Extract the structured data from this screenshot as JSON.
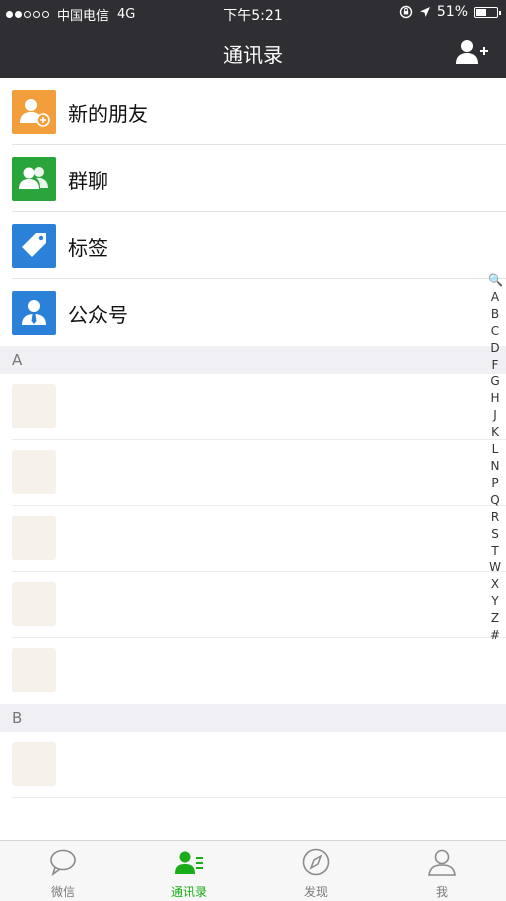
{
  "status_bar": {
    "carrier": "中国电信",
    "network": "4G",
    "time": "下午5:21",
    "battery": "51%",
    "battery_level": 0.51
  },
  "nav": {
    "title": "通讯录",
    "add_icon": "add-contact-icon"
  },
  "entries": [
    {
      "label": "新的朋友",
      "icon": "new-friends-icon",
      "color": "#f29f3b"
    },
    {
      "label": "群聊",
      "icon": "group-chat-icon",
      "color": "#2aa53c"
    },
    {
      "label": "标签",
      "icon": "tag-icon",
      "color": "#2b80d8"
    },
    {
      "label": "公众号",
      "icon": "official-account-icon",
      "color": "#2b80d8"
    }
  ],
  "sections": [
    {
      "letter": "A"
    },
    {
      "letter": "B"
    }
  ],
  "index_letters": [
    "🔍",
    "A",
    "B",
    "C",
    "D",
    "F",
    "G",
    "H",
    "J",
    "K",
    "L",
    "N",
    "P",
    "Q",
    "R",
    "S",
    "T",
    "W",
    "X",
    "Y",
    "Z",
    "#"
  ],
  "tabs": [
    {
      "label": "微信",
      "icon": "chat-icon",
      "active": false
    },
    {
      "label": "通讯录",
      "icon": "contacts-icon",
      "active": true
    },
    {
      "label": "发现",
      "icon": "compass-icon",
      "active": false
    },
    {
      "label": "我",
      "icon": "profile-icon",
      "active": false
    }
  ],
  "colors": {
    "accent": "#1aad19",
    "nav_bg": "#2e2e33",
    "section_bg": "#efeff4"
  }
}
